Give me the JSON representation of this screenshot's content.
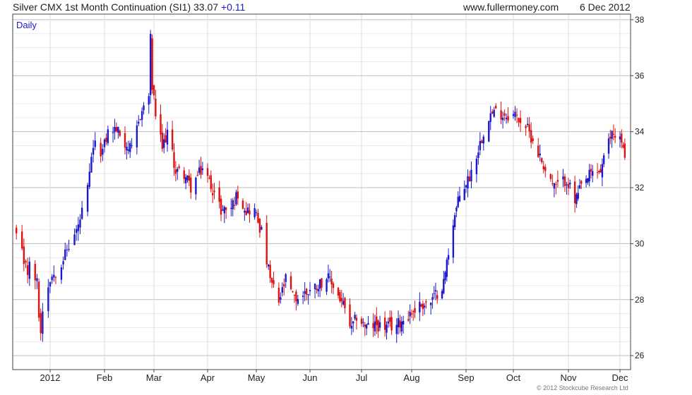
{
  "header": {
    "title": "Silver CMX 1st Month Continuation (SI1) 33.07",
    "change": "+0.11",
    "site": "www.fullermoney.com",
    "date": "6 Dec 2012"
  },
  "footer": {
    "copyright": "© 2012 Stockcube Research Ltd"
  },
  "colors": {
    "up": "#1a1acc",
    "down": "#e01010",
    "grid": "#d9d9d9",
    "axis": "#444444"
  },
  "chart_data": {
    "type": "candlestick",
    "period_label": "Daily",
    "ylim": [
      25.5,
      38.2
    ],
    "yticks": [
      26,
      28,
      30,
      32,
      34,
      36,
      38
    ],
    "x_tick_labels": [
      "2012",
      "Feb",
      "Mar",
      "Apr",
      "May",
      "Jun",
      "Jul",
      "Aug",
      "Sep",
      "Oct",
      "Nov",
      "Dec"
    ],
    "x_tick_dates": [
      "2012-01-03",
      "2012-02-01",
      "2012-03-01",
      "2012-04-02",
      "2012-05-01",
      "2012-06-01",
      "2012-07-02",
      "2012-08-01",
      "2012-09-04",
      "2012-10-01",
      "2012-11-01",
      "2012-12-03"
    ],
    "series": [
      {
        "date": "2011-12-16",
        "close": 30.3
      },
      {
        "date": "2011-12-19",
        "close": 29.6
      },
      {
        "date": "2011-12-20",
        "close": 29.1
      },
      {
        "date": "2011-12-21",
        "close": 29.4
      },
      {
        "date": "2011-12-22",
        "close": 29.0
      },
      {
        "date": "2011-12-23",
        "close": 29.2
      },
      {
        "date": "2011-12-27",
        "close": 28.6
      },
      {
        "date": "2011-12-28",
        "close": 27.5
      },
      {
        "date": "2011-12-29",
        "close": 26.8
      },
      {
        "date": "2011-12-30",
        "close": 27.7
      },
      {
        "date": "2012-01-03",
        "close": 28.8
      },
      {
        "date": "2012-01-06",
        "close": 29.0
      },
      {
        "date": "2012-01-10",
        "close": 29.5
      },
      {
        "date": "2012-01-13",
        "close": 29.9
      },
      {
        "date": "2012-01-18",
        "close": 30.6
      },
      {
        "date": "2012-01-23",
        "close": 31.9
      },
      {
        "date": "2012-01-26",
        "close": 33.5
      },
      {
        "date": "2012-01-31",
        "close": 33.3
      },
      {
        "date": "2012-02-03",
        "close": 34.0
      },
      {
        "date": "2012-02-08",
        "close": 34.1
      },
      {
        "date": "2012-02-13",
        "close": 33.6
      },
      {
        "date": "2012-02-17",
        "close": 33.3
      },
      {
        "date": "2012-02-22",
        "close": 34.6
      },
      {
        "date": "2012-02-27",
        "close": 35.3
      },
      {
        "date": "2012-02-28",
        "close": 37.3
      },
      {
        "date": "2012-02-29",
        "close": 35.6
      },
      {
        "date": "2012-03-02",
        "close": 34.6
      },
      {
        "date": "2012-03-06",
        "close": 33.4
      },
      {
        "date": "2012-03-09",
        "close": 34.0
      },
      {
        "date": "2012-03-14",
        "close": 32.6
      },
      {
        "date": "2012-03-19",
        "close": 32.5
      },
      {
        "date": "2012-03-23",
        "close": 32.0
      },
      {
        "date": "2012-03-28",
        "close": 32.5
      },
      {
        "date": "2012-03-30",
        "close": 32.7
      },
      {
        "date": "2012-04-04",
        "close": 32.1
      },
      {
        "date": "2012-04-10",
        "close": 31.2
      },
      {
        "date": "2012-04-16",
        "close": 31.3
      },
      {
        "date": "2012-04-20",
        "close": 31.8
      },
      {
        "date": "2012-04-25",
        "close": 31.2
      },
      {
        "date": "2012-04-30",
        "close": 31.2
      },
      {
        "date": "2012-05-04",
        "close": 30.4
      },
      {
        "date": "2012-05-09",
        "close": 28.7
      },
      {
        "date": "2012-05-14",
        "close": 27.9
      },
      {
        "date": "2012-05-18",
        "close": 28.7
      },
      {
        "date": "2012-05-23",
        "close": 28.0
      },
      {
        "date": "2012-05-31",
        "close": 28.3
      },
      {
        "date": "2012-06-05",
        "close": 28.5
      },
      {
        "date": "2012-06-11",
        "close": 28.8
      },
      {
        "date": "2012-06-15",
        "close": 28.5
      },
      {
        "date": "2012-06-21",
        "close": 27.8
      },
      {
        "date": "2012-06-26",
        "close": 26.9
      },
      {
        "date": "2012-06-29",
        "close": 27.4
      },
      {
        "date": "2012-07-05",
        "close": 27.0
      },
      {
        "date": "2012-07-11",
        "close": 27.1
      },
      {
        "date": "2012-07-17",
        "close": 27.0
      },
      {
        "date": "2012-07-23",
        "close": 27.1
      },
      {
        "date": "2012-07-31",
        "close": 27.5
      },
      {
        "date": "2012-08-06",
        "close": 27.8
      },
      {
        "date": "2012-08-13",
        "close": 27.9
      },
      {
        "date": "2012-08-21",
        "close": 28.6
      },
      {
        "date": "2012-08-27",
        "close": 30.8
      },
      {
        "date": "2012-08-31",
        "close": 31.7
      },
      {
        "date": "2012-09-06",
        "close": 32.4
      },
      {
        "date": "2012-09-12",
        "close": 33.6
      },
      {
        "date": "2012-09-17",
        "close": 34.6
      },
      {
        "date": "2012-09-21",
        "close": 34.7
      },
      {
        "date": "2012-09-27",
        "close": 34.6
      },
      {
        "date": "2012-10-02",
        "close": 34.6
      },
      {
        "date": "2012-10-08",
        "close": 34.2
      },
      {
        "date": "2012-10-12",
        "close": 33.7
      },
      {
        "date": "2012-10-18",
        "close": 32.8
      },
      {
        "date": "2012-10-24",
        "close": 32.0
      },
      {
        "date": "2012-10-31",
        "close": 32.3
      },
      {
        "date": "2012-11-05",
        "close": 31.5
      },
      {
        "date": "2012-11-09",
        "close": 32.0
      },
      {
        "date": "2012-11-15",
        "close": 32.5
      },
      {
        "date": "2012-11-21",
        "close": 32.6
      },
      {
        "date": "2012-11-28",
        "close": 34.0
      },
      {
        "date": "2012-12-03",
        "close": 33.8
      },
      {
        "date": "2012-12-06",
        "close": 33.07
      }
    ]
  }
}
